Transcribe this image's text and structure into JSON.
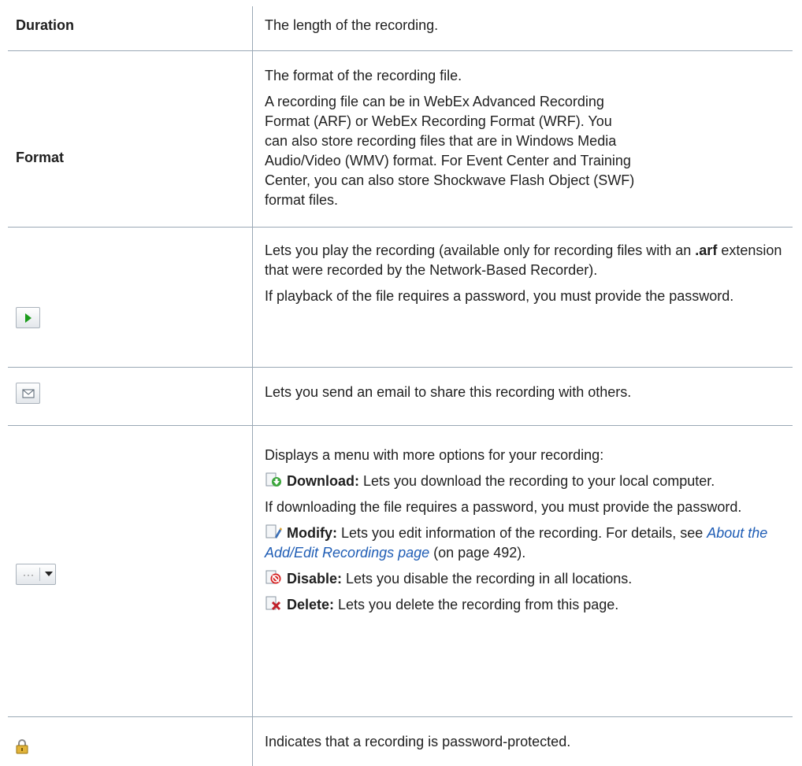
{
  "rows": {
    "duration": {
      "term": "Duration",
      "desc": "The length of the recording."
    },
    "format": {
      "term": "Format",
      "p1": "The format of the recording file.",
      "p2": "A recording file can be in WebEx Advanced Recording Format (ARF) or WebEx Recording Format (WRF). You can also store recording files that are in Windows Media Audio/Video (WMV) format. For Event Center and Training Center, you can also store Shockwave Flash Object (SWF) format files."
    },
    "play": {
      "icon": "play-icon",
      "p1_a": "Lets you play the recording (available only for recording files with an ",
      "p1_b": ".arf",
      "p1_c": " extension that were recorded by the Network-Based Recorder).",
      "p2": "If playback of the file requires a password, you must provide the password."
    },
    "email": {
      "icon": "envelope-icon",
      "desc": "Lets you send an email to share this recording with others."
    },
    "more": {
      "icon": "more-options-dropdown-icon",
      "intro": "Displays a menu with more options for your recording:",
      "download_label": "Download:",
      "download_text": " Lets you download the recording to your local computer.",
      "download_note": "If downloading the file requires a password, you must provide the password.",
      "modify_label": "Modify:",
      "modify_text": " Lets you edit information of the recording. For details, see ",
      "modify_link": "About the Add/Edit Recordings page",
      "modify_after": " (on page 492).",
      "disable_label": "Disable:",
      "disable_text": " Lets you disable the recording in all locations.",
      "delete_label": "Delete:",
      "delete_text": " Lets you delete the recording from this page."
    },
    "lock": {
      "icon": "lock-icon",
      "desc": "Indicates that a recording is password-protected."
    }
  }
}
